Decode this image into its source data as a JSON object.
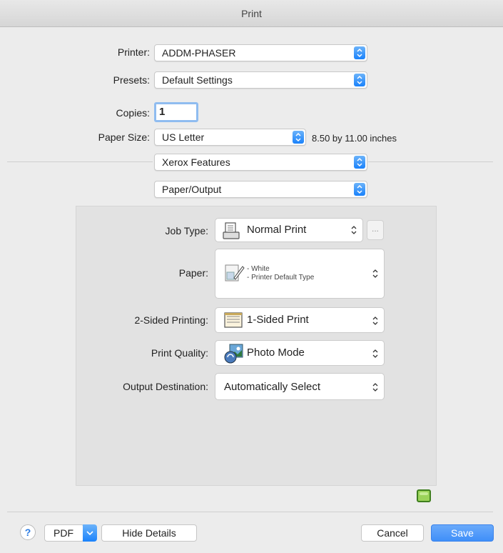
{
  "window": {
    "title": "Print"
  },
  "printer": {
    "label": "Printer:",
    "value": "ADDM-PHASER"
  },
  "presets": {
    "label": "Presets:",
    "value": "Default Settings"
  },
  "copies": {
    "label": "Copies:",
    "value": "1"
  },
  "paper_size": {
    "label": "Paper Size:",
    "value": "US Letter",
    "dimensions": "8.50 by 11.00 inches"
  },
  "feature_menu": {
    "value": "Xerox Features"
  },
  "section_menu": {
    "value": "Paper/Output"
  },
  "panel": {
    "job_type": {
      "label": "Job Type:",
      "value": "Normal Print",
      "more": "..."
    },
    "paper": {
      "label": "Paper:",
      "line1": "- White",
      "line2": "- Printer Default Type"
    },
    "two_sided": {
      "label": "2-Sided Printing:",
      "value": "1-Sided Print"
    },
    "print_quality": {
      "label": "Print Quality:",
      "value": "Photo Mode"
    },
    "output_destination": {
      "label": "Output Destination:",
      "value": "Automatically Select"
    }
  },
  "footer": {
    "help": "?",
    "pdf": "PDF",
    "hide_details": "Hide Details",
    "cancel": "Cancel",
    "save": "Save"
  },
  "colors": {
    "accent": "#1a82fb",
    "save_button": "#3f8ff9"
  },
  "icons": [
    "chevron-down-icon",
    "updown-arrows-icon",
    "document-icon",
    "paper-icon",
    "duplex-icon",
    "photo-icon",
    "status-icon",
    "help-icon"
  ]
}
